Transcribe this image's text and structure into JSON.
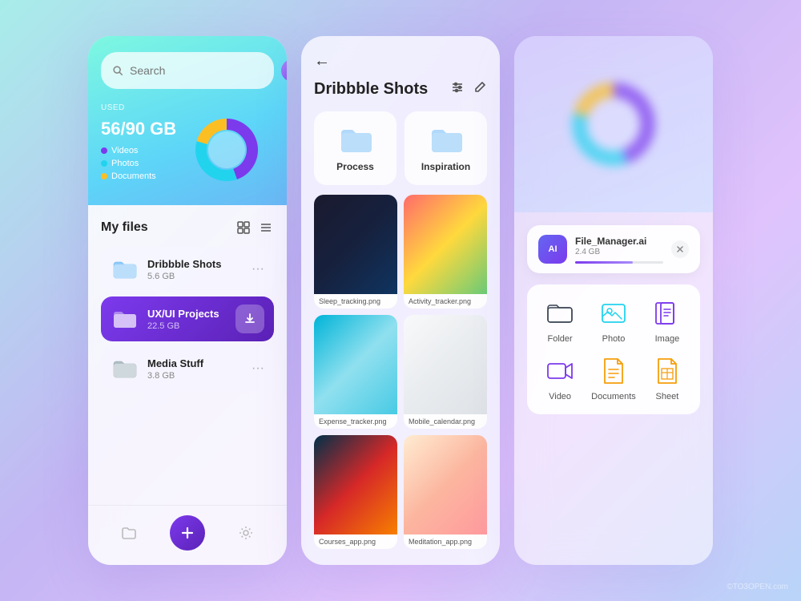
{
  "panel1": {
    "search": {
      "placeholder": "Search"
    },
    "storage": {
      "label": "USED",
      "amount": "56/90 GB",
      "legend": [
        {
          "id": "videos",
          "label": "Videos",
          "color": "#7c3aed"
        },
        {
          "id": "photos",
          "label": "Photos",
          "color": "#22d3ee"
        },
        {
          "id": "documents",
          "label": "Documents",
          "color": "#fbbf24"
        }
      ],
      "donut": {
        "videos_pct": 45,
        "photos_pct": 35,
        "documents_pct": 20
      }
    },
    "files_section": {
      "title": "My files"
    },
    "files": [
      {
        "id": "dribbble-shots",
        "name": "Dribbble Shots",
        "size": "5.6 GB",
        "active": false
      },
      {
        "id": "ux-ui-projects",
        "name": "UX/UI Projects",
        "size": "22.5 GB",
        "active": true
      },
      {
        "id": "media-stuff",
        "name": "Media Stuff",
        "size": "3.8 GB",
        "active": false
      }
    ],
    "fab_label": "+",
    "back_label": "←"
  },
  "panel2": {
    "back_label": "←",
    "title": "Dribbble Shots",
    "folders": [
      {
        "id": "process",
        "name": "Process"
      },
      {
        "id": "inspiration",
        "name": "Inspiration"
      }
    ],
    "images": [
      {
        "id": "sleep-tracking",
        "name": "Sleep_tracking.png",
        "thumb_class": "thumb-sleep"
      },
      {
        "id": "activity-tracker",
        "name": "Activity_tracker.png",
        "thumb_class": "thumb-activity"
      },
      {
        "id": "expense-tracker",
        "name": "Expense_tracker.png",
        "thumb_class": "thumb-expense"
      },
      {
        "id": "mobile-calendar",
        "name": "Mobile_calendar.png",
        "thumb_class": "thumb-mobile"
      },
      {
        "id": "courses-app",
        "name": "Courses_app.png",
        "thumb_class": "thumb-courses"
      },
      {
        "id": "meditation-app",
        "name": "Meditation_app.png",
        "thumb_class": "thumb-meditation"
      }
    ]
  },
  "panel3": {
    "upload": {
      "badge": "AI",
      "filename": "File_Manager.ai",
      "filesize": "2.4 GB"
    },
    "file_types": [
      {
        "id": "folder",
        "label": "Folder",
        "color": "#374151"
      },
      {
        "id": "photo",
        "label": "Photo",
        "color": "#22d3ee"
      },
      {
        "id": "image",
        "label": "Image",
        "color": "#7c3aed"
      },
      {
        "id": "video",
        "label": "Video",
        "color": "#7c3aed"
      },
      {
        "id": "documents",
        "label": "Documents",
        "color": "#f59e0b"
      },
      {
        "id": "sheet",
        "label": "Sheet",
        "color": "#f59e0b"
      }
    ]
  },
  "watermark": "©TO3OPEN.com"
}
